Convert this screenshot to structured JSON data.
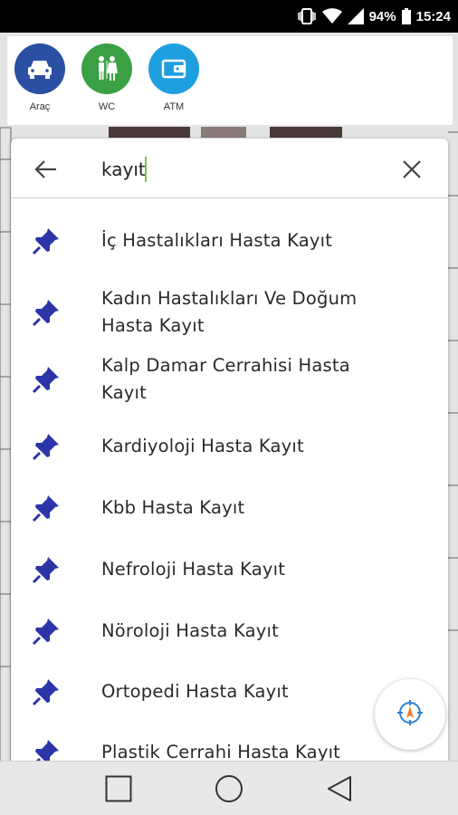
{
  "status_bar": {
    "battery": "94%",
    "time": "15:24"
  },
  "categories": [
    {
      "label": "Araç",
      "color": "#2b4fa3",
      "icon": "car-icon"
    },
    {
      "label": "WC",
      "color": "#3aa043",
      "icon": "restroom-icon"
    },
    {
      "label": "ATM",
      "color": "#1e9fe0",
      "icon": "wallet-icon"
    }
  ],
  "search": {
    "query": "kayıt",
    "back_icon": "arrow-left-icon",
    "clear_icon": "close-icon"
  },
  "results": [
    {
      "lines": [
        "İç Hastalıkları Hasta Kayıt"
      ]
    },
    {
      "lines": [
        "Kadın Hastalıkları Ve Doğum",
        "Hasta Kayıt"
      ]
    },
    {
      "lines": [
        "Kalp Damar Cerrahisi Hasta",
        "Kayıt"
      ]
    },
    {
      "lines": [
        "Kardiyoloji Hasta Kayıt"
      ]
    },
    {
      "lines": [
        "Kbb Hasta Kayıt"
      ]
    },
    {
      "lines": [
        "Nefroloji Hasta Kayıt"
      ]
    },
    {
      "lines": [
        "Nöroloji Hasta Kayıt"
      ]
    },
    {
      "lines": [
        "Ortopedi Hasta Kayıt"
      ]
    },
    {
      "lines": [
        "Plastik Cerrahi Hasta Kayıt"
      ]
    }
  ],
  "colors": {
    "pin": "#2b35a8",
    "accent_cursor": "#7cc142"
  }
}
